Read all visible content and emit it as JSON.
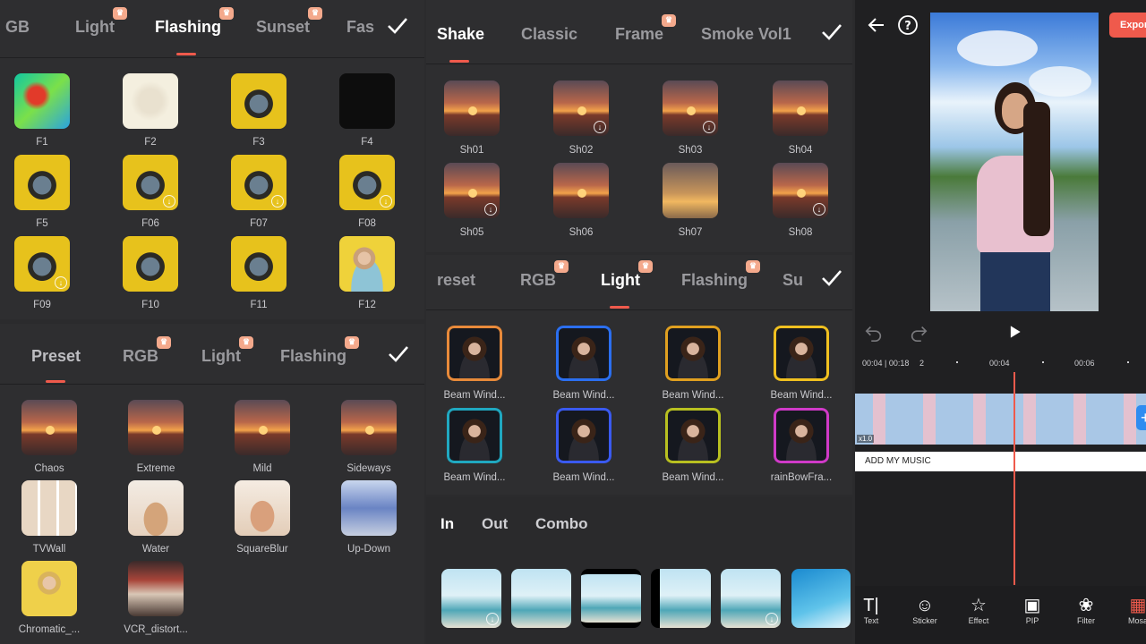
{
  "panel_a": {
    "tabs": [
      "GB",
      "Light",
      "Flashing",
      "Sunset",
      "Fas"
    ],
    "active_tab_index": 2,
    "tiles": [
      {
        "label": "F1"
      },
      {
        "label": "F2"
      },
      {
        "label": "F3"
      },
      {
        "label": "F4"
      },
      {
        "label": "F5"
      },
      {
        "label": "F06"
      },
      {
        "label": "F07"
      },
      {
        "label": "F08"
      },
      {
        "label": "F09"
      },
      {
        "label": "F10"
      },
      {
        "label": "F11"
      },
      {
        "label": "F12"
      }
    ]
  },
  "panel_b": {
    "tabs": [
      "Preset",
      "RGB",
      "Light",
      "Flashing"
    ],
    "active_tab_index": 0,
    "tiles": [
      {
        "label": "Chaos"
      },
      {
        "label": "Extreme"
      },
      {
        "label": "Mild"
      },
      {
        "label": "Sideways"
      },
      {
        "label": "TVWall"
      },
      {
        "label": "Water"
      },
      {
        "label": "SquareBlur"
      },
      {
        "label": "Up-Down"
      },
      {
        "label": "Chromatic_..."
      },
      {
        "label": "VCR_distort..."
      }
    ]
  },
  "panel_c": {
    "tabs": [
      "Shake",
      "Classic",
      "Frame",
      "Smoke Vol1"
    ],
    "active_tab_index": 0,
    "tiles": [
      {
        "label": "Sh01"
      },
      {
        "label": "Sh02"
      },
      {
        "label": "Sh03"
      },
      {
        "label": "Sh04"
      },
      {
        "label": "Sh05"
      },
      {
        "label": "Sh06"
      },
      {
        "label": "Sh07"
      },
      {
        "label": "Sh08"
      }
    ]
  },
  "panel_d": {
    "tabs": [
      "reset",
      "RGB",
      "Light",
      "Flashing",
      "Su"
    ],
    "active_tab_index": 2,
    "tiles": [
      {
        "label": "Beam Wind..."
      },
      {
        "label": "Beam Wind..."
      },
      {
        "label": "Beam Wind..."
      },
      {
        "label": "Beam Wind..."
      },
      {
        "label": "Beam Wind..."
      },
      {
        "label": "Beam Wind..."
      },
      {
        "label": "Beam Wind..."
      },
      {
        "label": "rainBowFra..."
      }
    ]
  },
  "panel_e": {
    "tabs": [
      "In",
      "Out",
      "Combo"
    ],
    "active_tab_index": 0
  },
  "editor": {
    "export_label": "Export",
    "time_current": "00:04",
    "time_total": "00:18",
    "ruler_labels": [
      "2",
      "00:04",
      "00:06"
    ],
    "speed_badge": "x1.0",
    "music_label": "ADD MY MUSIC",
    "tools": [
      {
        "label": "Text",
        "icon": "text-icon"
      },
      {
        "label": "Sticker",
        "icon": "sticker-icon"
      },
      {
        "label": "Effect",
        "icon": "effect-icon"
      },
      {
        "label": "PIP",
        "icon": "pip-icon"
      },
      {
        "label": "Filter",
        "icon": "filter-icon"
      },
      {
        "label": "Mosa",
        "icon": "mosaic-icon"
      }
    ]
  },
  "colors": {
    "accent": "#ef5a4c",
    "panel_bg": "#2e2e30",
    "editor_bg": "#202022",
    "premium_crown": "#f4a98c"
  }
}
